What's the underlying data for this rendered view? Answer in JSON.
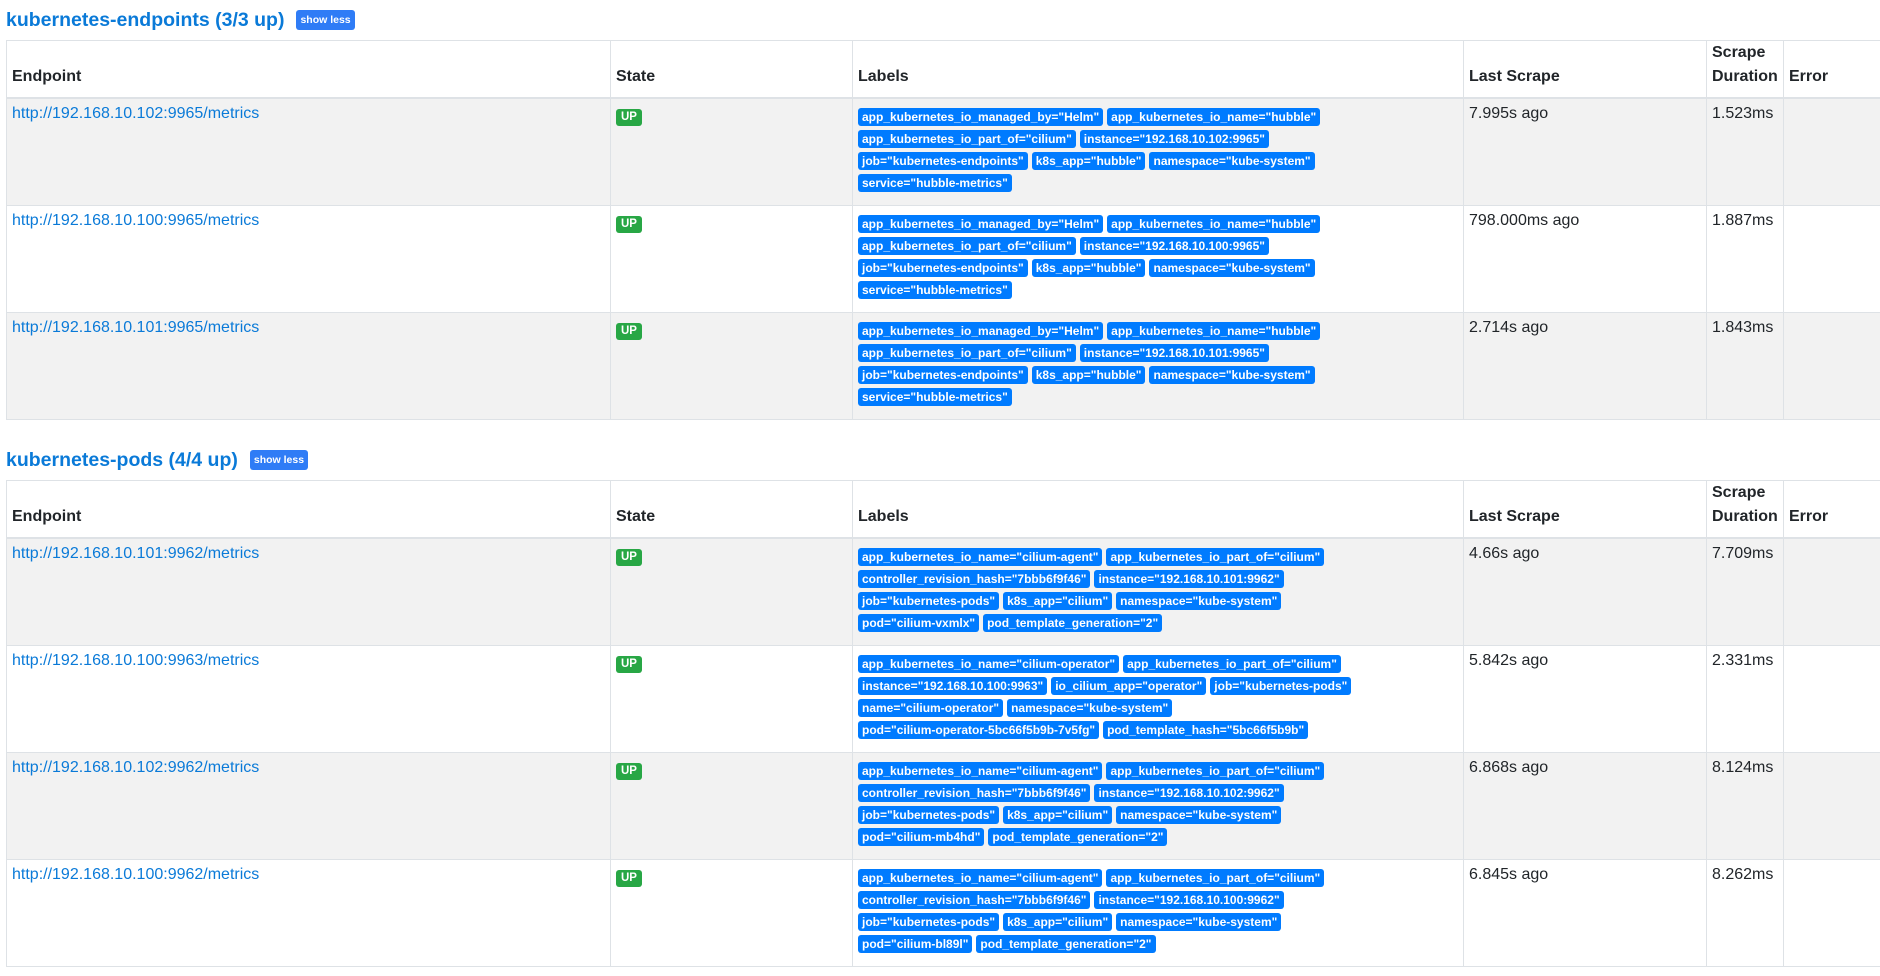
{
  "columns": {
    "endpoint": "Endpoint",
    "state": "State",
    "labels": "Labels",
    "last_scrape": "Last Scrape",
    "scrape_duration": "Scrape Duration",
    "error": "Error"
  },
  "groups": [
    {
      "title": "kubernetes-endpoints (3/3 up)",
      "toggle_label": "show less",
      "rows": [
        {
          "endpoint": "http://192.168.10.102:9965/metrics",
          "state": "UP",
          "labels": [
            "app_kubernetes_io_managed_by=\"Helm\"",
            "app_kubernetes_io_name=\"hubble\"",
            "app_kubernetes_io_part_of=\"cilium\"",
            "instance=\"192.168.10.102:9965\"",
            "job=\"kubernetes-endpoints\"",
            "k8s_app=\"hubble\"",
            "namespace=\"kube-system\"",
            "service=\"hubble-metrics\""
          ],
          "last_scrape": "7.995s ago",
          "scrape_duration": "1.523ms",
          "error": ""
        },
        {
          "endpoint": "http://192.168.10.100:9965/metrics",
          "state": "UP",
          "labels": [
            "app_kubernetes_io_managed_by=\"Helm\"",
            "app_kubernetes_io_name=\"hubble\"",
            "app_kubernetes_io_part_of=\"cilium\"",
            "instance=\"192.168.10.100:9965\"",
            "job=\"kubernetes-endpoints\"",
            "k8s_app=\"hubble\"",
            "namespace=\"kube-system\"",
            "service=\"hubble-metrics\""
          ],
          "last_scrape": "798.000ms ago",
          "scrape_duration": "1.887ms",
          "error": ""
        },
        {
          "endpoint": "http://192.168.10.101:9965/metrics",
          "state": "UP",
          "labels": [
            "app_kubernetes_io_managed_by=\"Helm\"",
            "app_kubernetes_io_name=\"hubble\"",
            "app_kubernetes_io_part_of=\"cilium\"",
            "instance=\"192.168.10.101:9965\"",
            "job=\"kubernetes-endpoints\"",
            "k8s_app=\"hubble\"",
            "namespace=\"kube-system\"",
            "service=\"hubble-metrics\""
          ],
          "last_scrape": "2.714s ago",
          "scrape_duration": "1.843ms",
          "error": ""
        }
      ]
    },
    {
      "title": "kubernetes-pods (4/4 up)",
      "toggle_label": "show less",
      "rows": [
        {
          "endpoint": "http://192.168.10.101:9962/metrics",
          "state": "UP",
          "labels": [
            "app_kubernetes_io_name=\"cilium-agent\"",
            "app_kubernetes_io_part_of=\"cilium\"",
            "controller_revision_hash=\"7bbb6f9f46\"",
            "instance=\"192.168.10.101:9962\"",
            "job=\"kubernetes-pods\"",
            "k8s_app=\"cilium\"",
            "namespace=\"kube-system\"",
            "pod=\"cilium-vxmlx\"",
            "pod_template_generation=\"2\""
          ],
          "last_scrape": "4.66s ago",
          "scrape_duration": "7.709ms",
          "error": ""
        },
        {
          "endpoint": "http://192.168.10.100:9963/metrics",
          "state": "UP",
          "labels": [
            "app_kubernetes_io_name=\"cilium-operator\"",
            "app_kubernetes_io_part_of=\"cilium\"",
            "instance=\"192.168.10.100:9963\"",
            "io_cilium_app=\"operator\"",
            "job=\"kubernetes-pods\"",
            "name=\"cilium-operator\"",
            "namespace=\"kube-system\"",
            "pod=\"cilium-operator-5bc66f5b9b-7v5fg\"",
            "pod_template_hash=\"5bc66f5b9b\""
          ],
          "last_scrape": "5.842s ago",
          "scrape_duration": "2.331ms",
          "error": ""
        },
        {
          "endpoint": "http://192.168.10.102:9962/metrics",
          "state": "UP",
          "labels": [
            "app_kubernetes_io_name=\"cilium-agent\"",
            "app_kubernetes_io_part_of=\"cilium\"",
            "controller_revision_hash=\"7bbb6f9f46\"",
            "instance=\"192.168.10.102:9962\"",
            "job=\"kubernetes-pods\"",
            "k8s_app=\"cilium\"",
            "namespace=\"kube-system\"",
            "pod=\"cilium-mb4hd\"",
            "pod_template_generation=\"2\""
          ],
          "last_scrape": "6.868s ago",
          "scrape_duration": "8.124ms",
          "error": ""
        },
        {
          "endpoint": "http://192.168.10.100:9962/metrics",
          "state": "UP",
          "labels": [
            "app_kubernetes_io_name=\"cilium-agent\"",
            "app_kubernetes_io_part_of=\"cilium\"",
            "controller_revision_hash=\"7bbb6f9f46\"",
            "instance=\"192.168.10.100:9962\"",
            "job=\"kubernetes-pods\"",
            "k8s_app=\"cilium\"",
            "namespace=\"kube-system\"",
            "pod=\"cilium-bl89l\"",
            "pod_template_generation=\"2\""
          ],
          "last_scrape": "6.845s ago",
          "scrape_duration": "8.262ms",
          "error": ""
        }
      ]
    }
  ],
  "colors": {
    "link": "#0a7ad8",
    "label_badge": "#007bff",
    "state_up": "#28a745",
    "toggle_button": "#2f7cf6",
    "row_stripe": "#f2f2f2"
  }
}
